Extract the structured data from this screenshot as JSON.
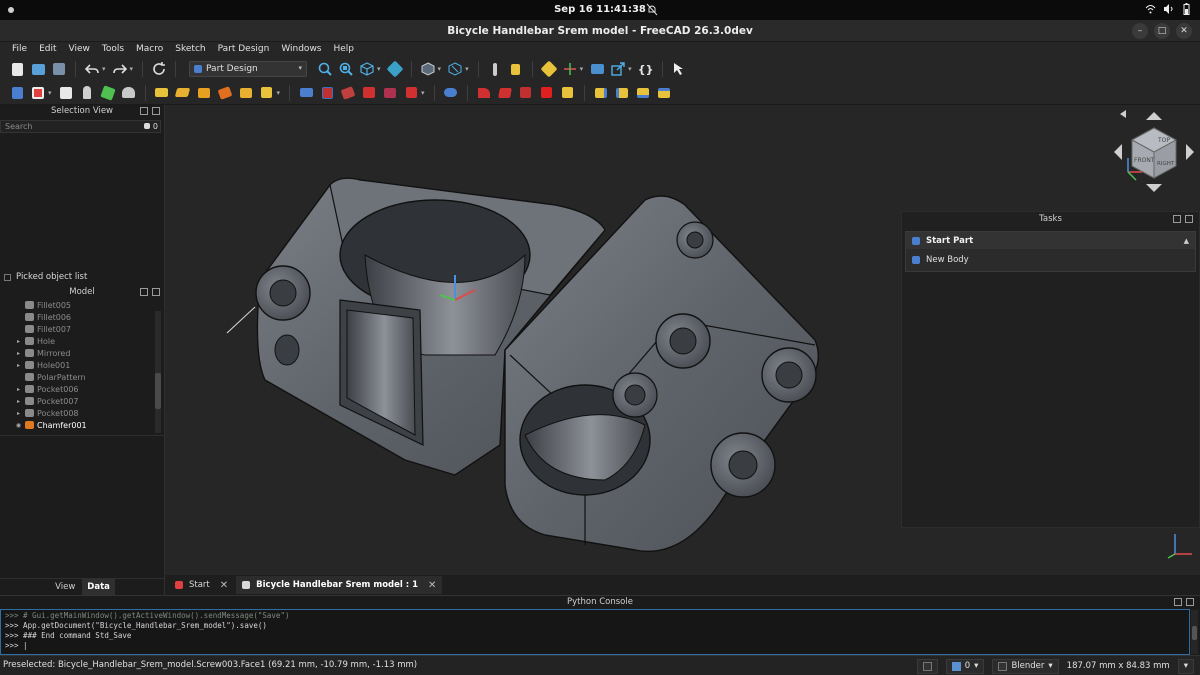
{
  "system": {
    "clock": "Sep 16  11:41:38"
  },
  "window": {
    "title": "Bicycle Handlebar Srem model - FreeCAD 26.3.0dev"
  },
  "menu": [
    "File",
    "Edit",
    "View",
    "Tools",
    "Macro",
    "Sketch",
    "Part Design",
    "Windows",
    "Help"
  ],
  "toolbar": {
    "workbench": "Part Design",
    "macro_label": "{}"
  },
  "colors": {
    "accent": "#4a7fd0",
    "body": "#5f636a",
    "background": "#262626"
  },
  "selection_view": {
    "title": "Selection View",
    "search_placeholder": "Search",
    "count": "0",
    "picked_label": "Picked object list"
  },
  "model": {
    "title": "Model",
    "items": [
      {
        "label": "Fillet005",
        "expandable": false
      },
      {
        "label": "Fillet006",
        "expandable": false
      },
      {
        "label": "Fillet007",
        "expandable": false
      },
      {
        "label": "Hole",
        "expandable": true
      },
      {
        "label": "Mirrored",
        "expandable": true
      },
      {
        "label": "Hole001",
        "expandable": true
      },
      {
        "label": "PolarPattern",
        "expandable": false
      },
      {
        "label": "Pocket006",
        "expandable": true
      },
      {
        "label": "Pocket007",
        "expandable": true
      },
      {
        "label": "Pocket008",
        "expandable": true
      },
      {
        "label": "Chamfer001",
        "expandable": false,
        "active": true
      }
    ]
  },
  "prop_tabs": {
    "view": "View",
    "data": "Data"
  },
  "tasks": {
    "title": "Tasks",
    "box_title": "Start Part",
    "action": "New Body"
  },
  "navcube": {
    "top": "TOP",
    "front": "FRONT",
    "right": "RIGHT"
  },
  "doc_tabs": [
    {
      "label": "Start",
      "active": false
    },
    {
      "label": "Bicycle Handlebar Srem model : 1",
      "active": true
    }
  ],
  "console": {
    "title": "Python Console",
    "lines": [
      ">>> # Gui.getMainWindow().getActiveWindow().sendMessage(\"Save\")",
      ">>> App.getDocument(\"Bicycle_Handlebar_Srem_model\").save()",
      ">>> ### End command Std_Save",
      ">>> |"
    ]
  },
  "status": {
    "message": "Preselected: Bicycle_Handlebar_Srem_model.Screw003.Face1 (69.21 mm, -10.79 mm, -1.13 mm)",
    "layer_count": "0",
    "nav_style": "Blender",
    "dimensions": "187.07 mm x 84.83 mm"
  }
}
